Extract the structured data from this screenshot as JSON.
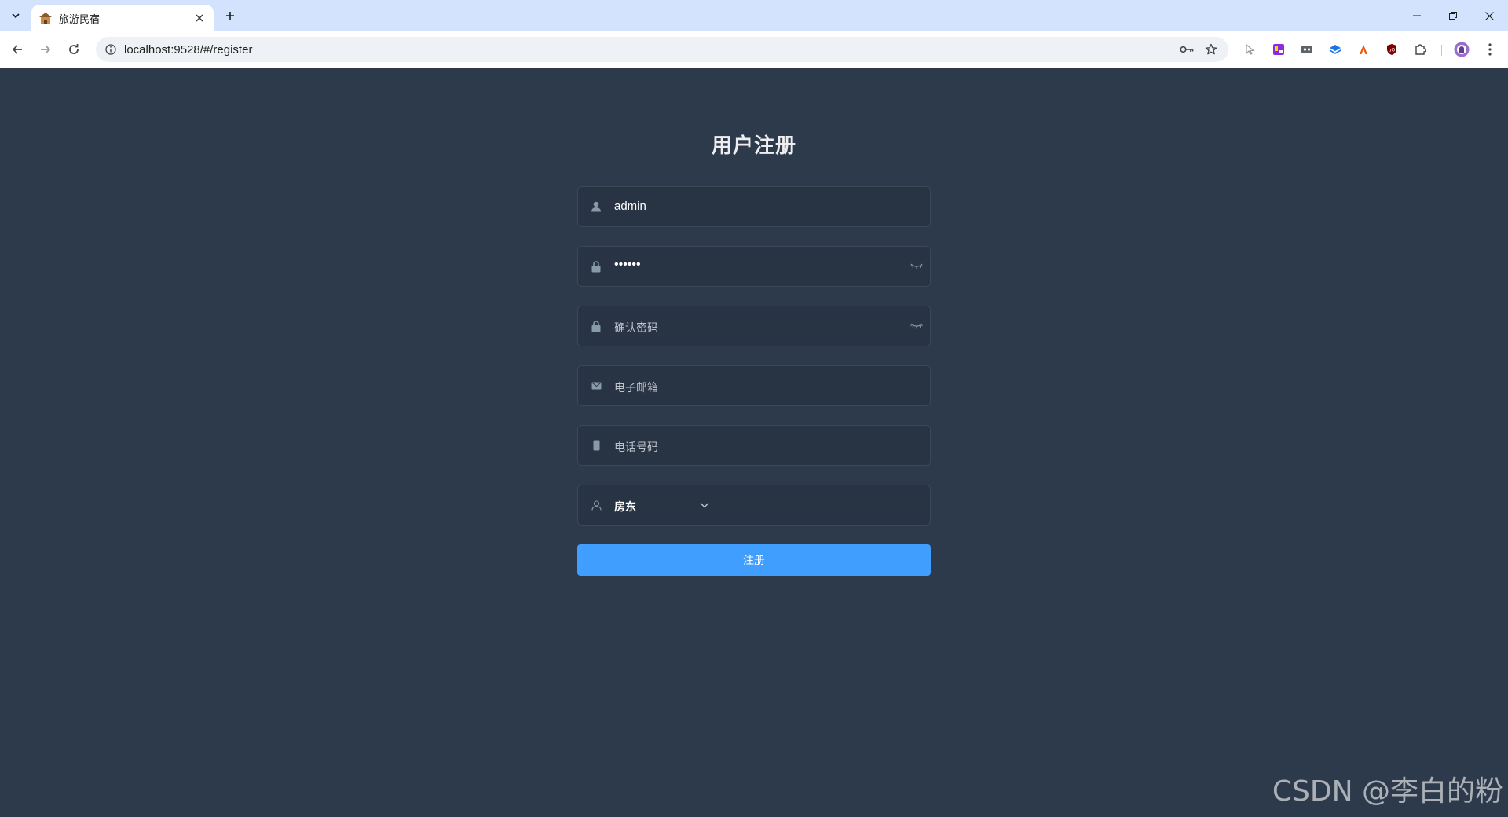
{
  "browser": {
    "tab_title": "旅游民宿",
    "url": "localhost:9528/#/register",
    "window_controls": [
      "minimize",
      "restore",
      "close"
    ]
  },
  "page": {
    "title": "用户注册",
    "fields": {
      "username": {
        "value": "admin",
        "icon": "user-icon"
      },
      "password": {
        "value": "••••••",
        "icon": "lock-icon"
      },
      "confirm_password": {
        "placeholder": "确认密码",
        "icon": "lock-icon"
      },
      "email": {
        "placeholder": "电子邮箱",
        "icon": "mail-icon"
      },
      "phone": {
        "placeholder": "电话号码",
        "icon": "phone-icon"
      },
      "role": {
        "selected": "房东",
        "icon": "user-outline-icon"
      }
    },
    "submit_label": "注册"
  },
  "watermark": "CSDN @李白的粉",
  "colors": {
    "background": "#2d3a4b",
    "input_bg": "#283443",
    "primary": "#409eff"
  }
}
